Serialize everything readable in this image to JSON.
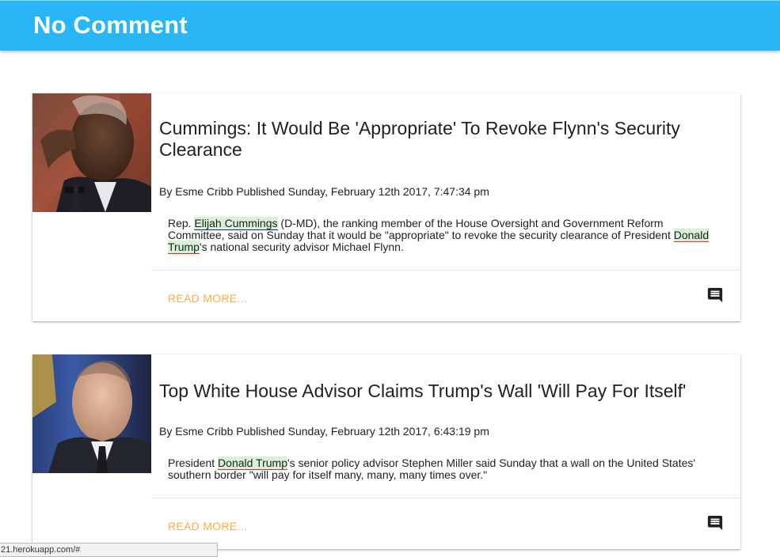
{
  "app": {
    "title": "No Comment"
  },
  "colors": {
    "header": "#29b6f6",
    "accent": "#ffab40",
    "entity_highlight": "#d8f2d6"
  },
  "articles": [
    {
      "headline": "Cummings: It Would Be 'Appropriate' To Revoke Flynn's Security Clearance",
      "byline": "By Esme Cribb Published Sunday, February 12th 2017, 7:47:34 pm",
      "snippet": {
        "t1": "Rep. ",
        "e1": "Elijah Cummings",
        "t2": " (D-MD), the ranking member of the House Oversight and Government Reform Committee, said on Sunday that it would be \"appropriate\" to revoke the security clearance of President ",
        "e2": "Donald Trump",
        "t3": "'s national security advisor Michael Flynn."
      },
      "read_more": "READ MORE...",
      "comment_icon": "comment-icon",
      "image": "portrait-photo"
    },
    {
      "headline": "Top White House Advisor Claims Trump's Wall 'Will Pay For Itself'",
      "byline": "By Esme Cribb Published Sunday, February 12th 2017, 6:43:19 pm",
      "snippet": {
        "t1": "President ",
        "e1": "Donald Trump",
        "t2": "'s senior policy advisor Stephen Miller said Sunday that a wall on the United States' southern border \"will pay for itself many, many, many times over.\""
      },
      "read_more": "READ MORE...",
      "comment_icon": "comment-icon",
      "image": "portrait-photo"
    }
  ],
  "status_bar": {
    "url": "21.herokuapp.com/#"
  }
}
